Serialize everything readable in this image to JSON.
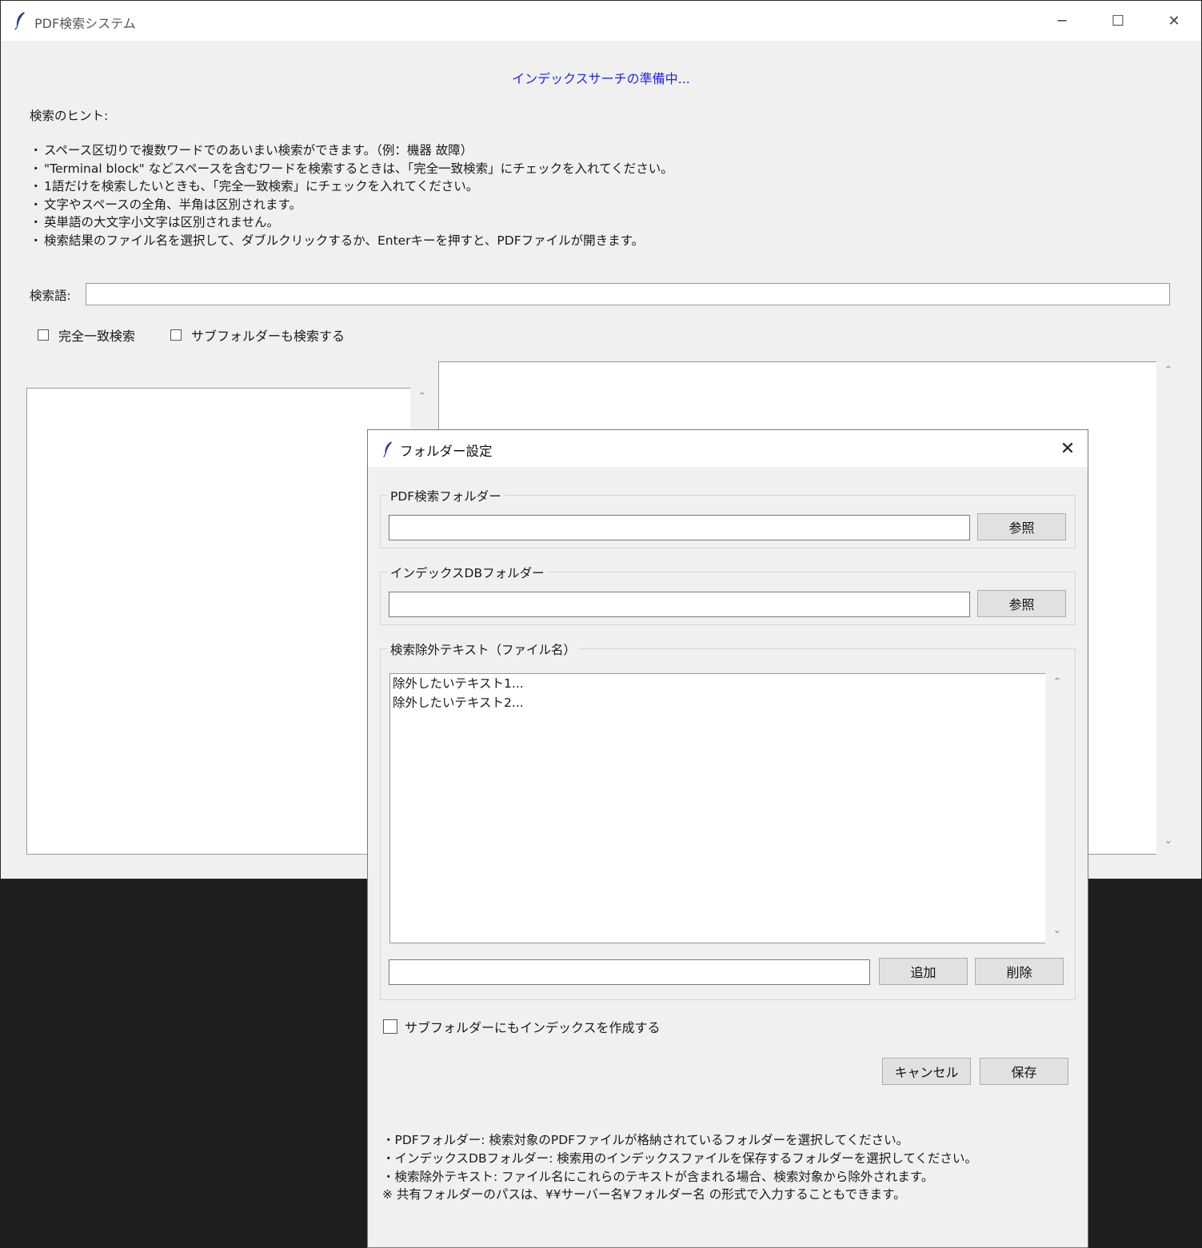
{
  "main_window": {
    "title": "PDF検索システム",
    "controls": {
      "minimize": "─",
      "maximize": "☐",
      "close": "✕"
    },
    "status_text": "インデックスサーチの準備中...",
    "hints_title": "検索のヒント:",
    "hints": [
      "スペース区切りで複数ワードでのあいまい検索ができます。（例：機器 故障）",
      "\"Terminal block\" などスペースを含むワードを検索するときは、「完全一致検索」にチェックを入れてください。",
      "1語だけを検索したいときも、「完全一致検索」にチェックを入れてください。",
      "文字やスペースの全角、半角は区別されます。",
      "英単語の大文字小文字は区別されません。",
      "検索結果のファイル名を選択して、ダブルクリックするか、Enterキーを押すと、PDFファイルが開きます。"
    ],
    "hint_bullet": "・",
    "search_label": "検索語:",
    "search_value": "",
    "checkboxes": [
      {
        "label": "完全一致検索",
        "checked": false
      },
      {
        "label": "サブフォルダーも検索する",
        "checked": false
      }
    ],
    "scroll_up": "⌃",
    "scroll_down": "⌄"
  },
  "dialog": {
    "title": "フォルダー設定",
    "close": "✕",
    "pdf_folder": {
      "label": "PDF検索フォルダー",
      "value": "",
      "browse": "参照"
    },
    "index_folder": {
      "label": "インデックスDBフォルダー",
      "value": "",
      "browse": "参照"
    },
    "exclude": {
      "label": "検索除外テキスト（ファイル名）",
      "items": [
        "除外したいテキスト1...",
        "除外したいテキスト2..."
      ],
      "input_value": "",
      "add": "追加",
      "remove": "削除"
    },
    "subfolder_index": {
      "label": "サブフォルダーにもインデックスを作成する",
      "checked": false
    },
    "cancel": "キャンセル",
    "save": "保存",
    "notes": [
      "・PDFフォルダー: 検索対象のPDFファイルが格納されているフォルダーを選択してください。",
      "・インデックスDBフォルダー: 検索用のインデックスファイルを保存するフォルダーを選択してください。",
      "・検索除外テキスト: ファイル名にこれらのテキストが含まれる場合、検索対象から除外されます。",
      "※ 共有フォルダーのパスは、¥¥サーバー名¥フォルダー名 の形式で入力することもできます。"
    ]
  },
  "colors": {
    "status": "#1f1fff",
    "window_bg": "#f0f0f0",
    "backdrop": "#1e1e1e"
  },
  "icons": {
    "app": "feather-icon"
  }
}
